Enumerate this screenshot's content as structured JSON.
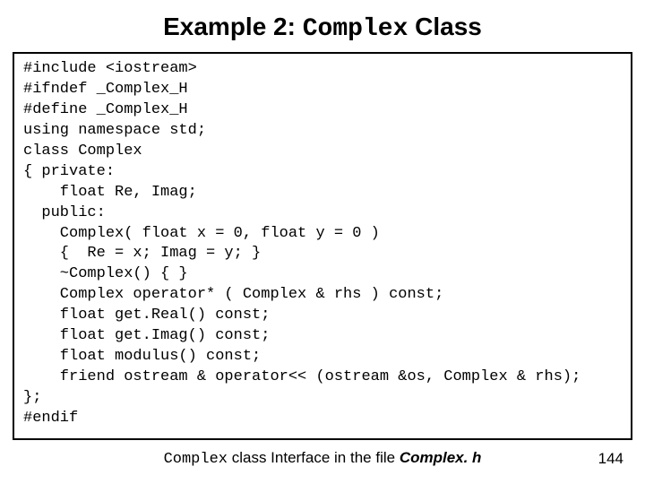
{
  "title_prefix": "Example 2: ",
  "title_code": "Complex",
  "title_suffix": " Class",
  "code_lines": [
    "#include <iostream>",
    "#ifndef _Complex_H",
    "#define _Complex_H",
    "using namespace std;",
    "class Complex",
    "{ private:",
    "    float Re, Imag;",
    "  public:",
    "    Complex( float x = 0, float y = 0 )",
    "    {  Re = x; Imag = y; }",
    "    ~Complex() { }",
    "    Complex operator* ( Complex & rhs ) const;",
    "    float get.Real() const;",
    "    float get.Imag() const;",
    "    float modulus() const;",
    "    friend ostream & operator<< (ostream &os, Complex & rhs);",
    "};",
    "#endif"
  ],
  "caption_code": "Complex",
  "caption_mid": "  class Interface in the file ",
  "caption_file": "Complex. h",
  "page_number": "144"
}
